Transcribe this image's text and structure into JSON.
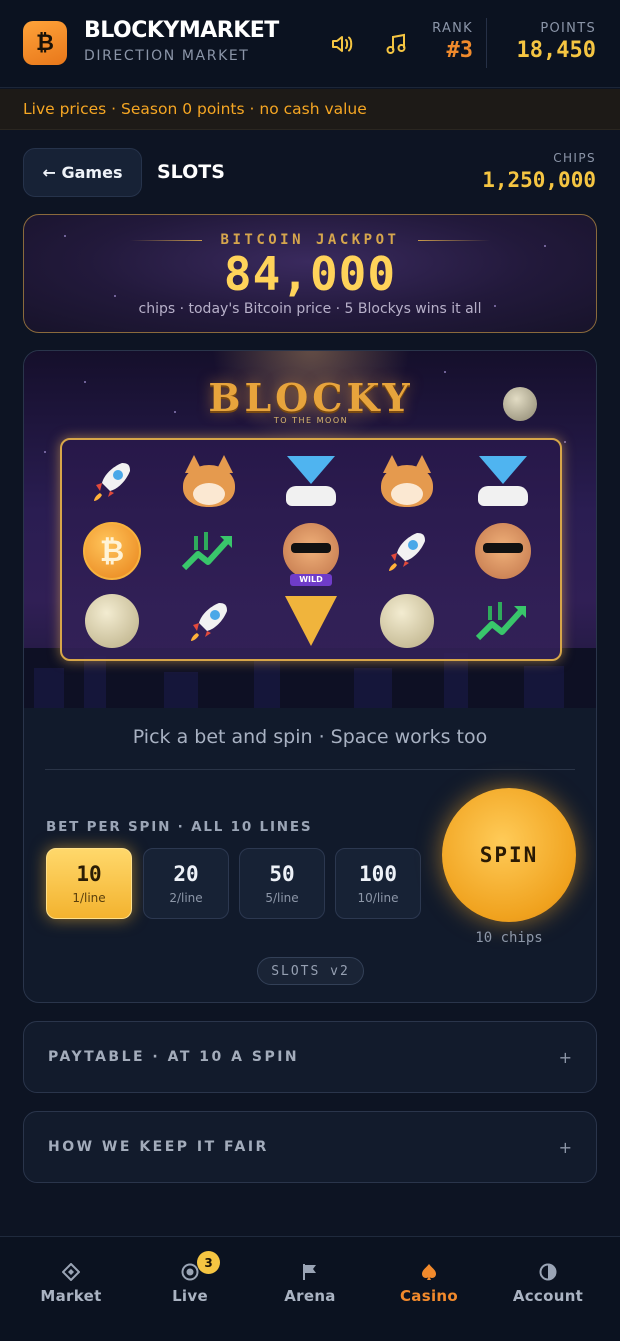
{
  "header": {
    "brand": "BLOCKYMARKET",
    "subtitle": "DIRECTION MARKET",
    "logo_glyph": "₿",
    "rank_label": "RANK",
    "rank_value": "#3",
    "points_label": "POINTS",
    "points_value": "18,450",
    "icons": [
      "sound-icon",
      "music-icon"
    ]
  },
  "ticker": {
    "text": "Live prices · Season 0 points · no cash value"
  },
  "nav": {
    "back_label": "← Games",
    "title": "SLOTS",
    "chips_label": "CHIPS",
    "chips_value": "1,250,000"
  },
  "jackpot": {
    "title": "BITCOIN JACKPOT",
    "value": "84,000",
    "subtitle": "chips · today's Bitcoin price · 5 Blockys wins it all"
  },
  "game": {
    "logo": "BLOCKY",
    "logo_sub": "TO THE MOON",
    "wild_label": "WILD",
    "reels": [
      [
        "rocket",
        "coin",
        "moon"
      ],
      [
        "dog",
        "chart",
        "rocket"
      ],
      [
        "diamond",
        "face-wild",
        "pizza"
      ],
      [
        "dog",
        "rocket",
        "moon"
      ],
      [
        "diamond",
        "face",
        "chart"
      ]
    ],
    "caption": "Pick a bet and spin · Space works too"
  },
  "bet": {
    "label": "BET PER SPIN · ALL 10 LINES",
    "options": [
      {
        "value": "10",
        "sub": "1/line",
        "selected": true
      },
      {
        "value": "20",
        "sub": "2/line",
        "selected": false
      },
      {
        "value": "50",
        "sub": "5/line",
        "selected": false
      },
      {
        "value": "100",
        "sub": "10/line",
        "selected": false
      }
    ],
    "spin_label": "SPIN",
    "spin_sub": "10 chips",
    "version": "SLOTS v2"
  },
  "accordions": [
    {
      "title": "PAYTABLE · AT 10 A SPIN",
      "toggle": "+"
    },
    {
      "title": "HOW WE KEEP IT FAIR",
      "toggle": "+"
    }
  ],
  "bottom_nav": [
    {
      "label": "Market",
      "icon": "market-icon",
      "active": false
    },
    {
      "label": "Live",
      "icon": "live-icon",
      "active": false,
      "badge": "3"
    },
    {
      "label": "Arena",
      "icon": "flag-icon",
      "active": false
    },
    {
      "label": "Casino",
      "icon": "spade-icon",
      "active": true
    },
    {
      "label": "Account",
      "icon": "account-icon",
      "active": false
    }
  ],
  "colors": {
    "accent_orange": "#f28a2c",
    "gold": "#f5c542",
    "background": "#0d1423"
  }
}
